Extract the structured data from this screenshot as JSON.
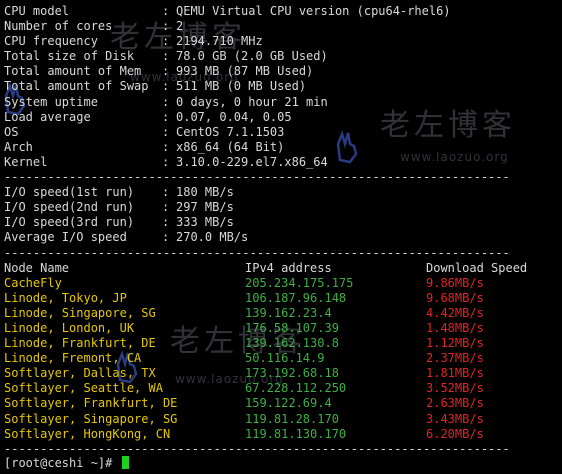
{
  "sysinfo": [
    {
      "label": "CPU model",
      "value": "QEMU Virtual CPU version (cpu64-rhel6)"
    },
    {
      "label": "Number of cores",
      "value": "2"
    },
    {
      "label": "CPU frequency",
      "value": "2194.710 MHz"
    },
    {
      "label": "Total size of Disk",
      "value": "78.0 GB (2.0 GB Used)"
    },
    {
      "label": "Total amount of Mem",
      "value": "993 MB (87 MB Used)"
    },
    {
      "label": "Total amount of Swap",
      "value": "511 MB (0 MB Used)"
    },
    {
      "label": "System uptime",
      "value": "0 days, 0 hour 21 min"
    },
    {
      "label": "Load average",
      "value": "0.07, 0.04, 0.05"
    },
    {
      "label": "OS",
      "value": "CentOS 7.1.1503"
    },
    {
      "label": "Arch",
      "value": "x86_64 (64 Bit)"
    },
    {
      "label": "Kernel",
      "value": "3.10.0-229.el7.x86_64"
    }
  ],
  "separator": "----------------------------------------------------------------------",
  "io": [
    {
      "label": "I/O speed(1st run)",
      "value": "180 MB/s"
    },
    {
      "label": "I/O speed(2nd run)",
      "value": "297 MB/s"
    },
    {
      "label": "I/O speed(3rd run)",
      "value": "333 MB/s"
    },
    {
      "label": "Average I/O speed",
      "value": "270.0 MB/s"
    }
  ],
  "speedtest": {
    "headers": {
      "node": "Node Name",
      "ip": "IPv4 address",
      "speed": "Download Speed"
    },
    "rows": [
      {
        "node": "CacheFly",
        "ip": "205.234.175.175",
        "speed": "9.86MB/s"
      },
      {
        "node": "Linode, Tokyo, JP",
        "ip": "106.187.96.148",
        "speed": "9.68MB/s"
      },
      {
        "node": "Linode, Singapore, SG",
        "ip": "139.162.23.4",
        "speed": "4.42MB/s"
      },
      {
        "node": "Linode, London, UK",
        "ip": "176.58.107.39",
        "speed": "1.48MB/s"
      },
      {
        "node": "Linode, Frankfurt, DE",
        "ip": "139.162.130.8",
        "speed": "1.12MB/s"
      },
      {
        "node": "Linode, Fremont, CA",
        "ip": "50.116.14.9",
        "speed": "2.37MB/s"
      },
      {
        "node": "Softlayer, Dallas, TX",
        "ip": "173.192.68.18",
        "speed": "1.81MB/s"
      },
      {
        "node": "Softlayer, Seattle, WA",
        "ip": "67.228.112.250",
        "speed": "3.52MB/s"
      },
      {
        "node": "Softlayer, Frankfurt, DE",
        "ip": "159.122.69.4",
        "speed": "2.63MB/s"
      },
      {
        "node": "Softlayer, Singapore, SG",
        "ip": "119.81.28.170",
        "speed": "3.43MB/s"
      },
      {
        "node": "Softlayer, HongKong, CN",
        "ip": "119.81.130.170",
        "speed": "6.20MB/s"
      }
    ]
  },
  "prompt": "[root@ceshi ~]# ",
  "watermark": {
    "text": "老左博客",
    "url": "www.laozuo.org"
  },
  "colors": {
    "background": "#000000",
    "text": "#d9d9d9",
    "node": "#e5c800",
    "ip": "#3cb043",
    "speed": "#e02424",
    "cursor": "#1fd11f"
  }
}
